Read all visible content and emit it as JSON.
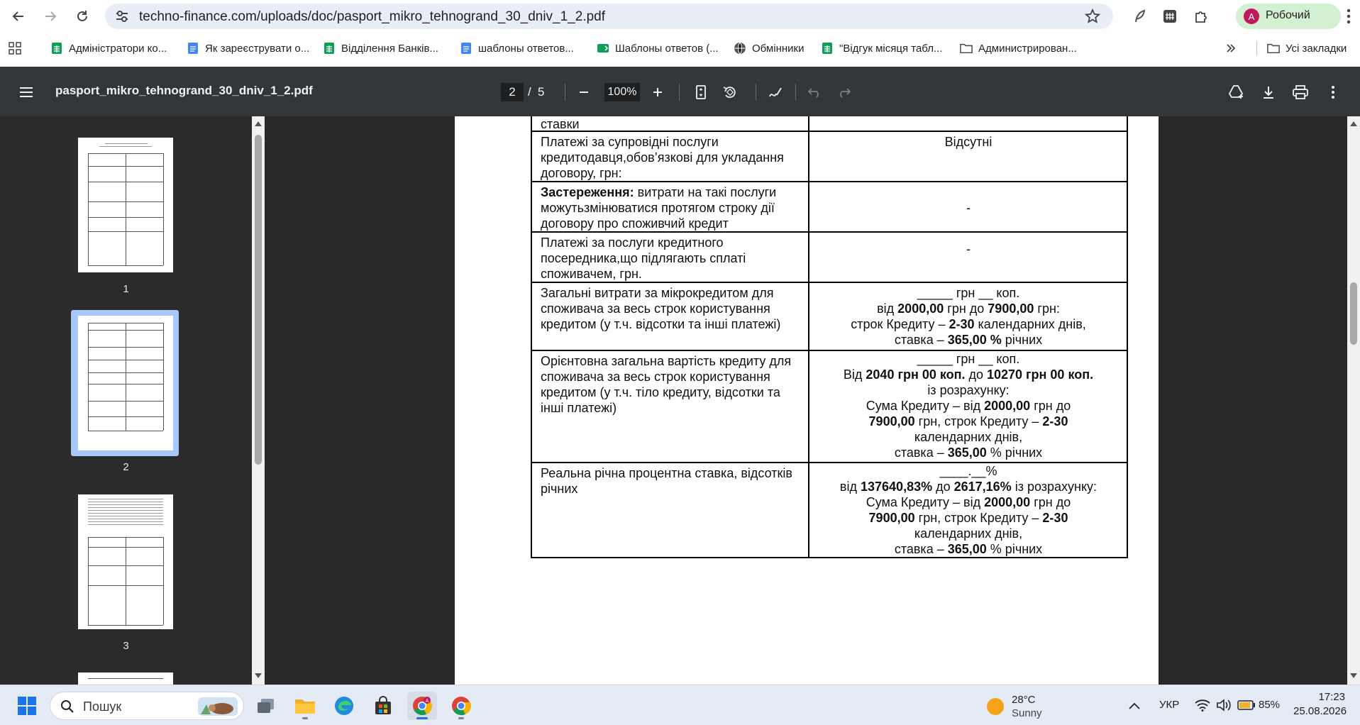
{
  "browser": {
    "url": "techno-finance.com/uploads/doc/pasport_mikro_tehnogrand_30_dniv_1_2.pdf",
    "profile_initial": "A",
    "profile_name": "Робочий",
    "accent_color": "#1a73e8"
  },
  "bookmarks": [
    {
      "label": "Адміністратори ко...",
      "icon": "sheets-icon"
    },
    {
      "label": "Як зареєструвати о...",
      "icon": "docs-icon"
    },
    {
      "label": "Відділення Банків...",
      "icon": "sheets-icon"
    },
    {
      "label": "шаблоны ответов...",
      "icon": "docs-icon"
    },
    {
      "label": "Шаблоны ответов (...",
      "icon": "slides-icon"
    },
    {
      "label": "Обмінники",
      "icon": "globe-icon"
    },
    {
      "label": "\"Відгук місяця табл...",
      "icon": "sheets-icon"
    },
    {
      "label": "Администрирован...",
      "icon": "folder-icon"
    }
  ],
  "all_bookmarks_label": "Усі закладки",
  "pdf": {
    "filename": "pasport_mikro_tehnogrand_30_dniv_1_2.pdf",
    "current_page": "2",
    "page_separator": "/",
    "total_pages": "5",
    "zoom": "100%"
  },
  "thumbnails": [
    {
      "number": "1"
    },
    {
      "number": "2"
    },
    {
      "number": "3"
    }
  ],
  "document": {
    "top_fragment": "ставки",
    "rows": [
      {
        "left": "Платежі за супровідні послуги кредитодавця,обов’язкові для укладання договору, грн:",
        "right": "Відсутні"
      },
      {
        "left_bold": "Застереження:",
        "left": " витрати на такі послуги можутьзмінюватися протягом строку дії договору про споживчий кредит",
        "right": "-"
      },
      {
        "left": "Платежі за послуги кредитного посередника,що підлягають сплаті споживачем, грн.",
        "right": "-"
      },
      {
        "left": "Загальні витрати за мікрокредитом для споживача за весь строк користування кредитом (у т.ч. відсотки та інші платежі)",
        "right_lines": [
          [
            "_____ грн __ коп."
          ],
          [
            "від ",
            "*2000,00",
            " грн до ",
            "*7900,00",
            " грн:"
          ],
          [
            "строк Кредиту – ",
            "*2-30",
            " календарних днів,"
          ],
          [
            "ставка – ",
            "*365,00 %",
            " річних"
          ]
        ]
      },
      {
        "left": "Орієнтовна загальна вартість кредиту для споживача за весь строк користування кредитом (у т.ч. тіло кредиту, відсотки та інші платежі)",
        "right_lines": [
          [
            "_____ грн __ коп."
          ],
          [
            "Від ",
            "*2040 грн 00 коп.",
            " до ",
            "*10270 грн 00 коп."
          ],
          [
            "із розрахунку:"
          ],
          [
            "Сума Кредиту – від ",
            "*2000,00",
            " грн до"
          ],
          [
            "*7900,00",
            " грн, строк Кредиту – ",
            "*2-30"
          ],
          [
            "календарних днів,"
          ],
          [
            "ставка – ",
            "*365,00",
            "  % річних"
          ]
        ]
      },
      {
        "left": "Реальна річна процентна ставка, відсотків річних",
        "right_lines": [
          [
            "____.__%"
          ],
          [
            "від ",
            "*137640,83%",
            " до  ",
            "*2617,16%",
            " із розрахунку:"
          ],
          [
            "Сума Кредиту – від ",
            "*2000,00",
            " грн до"
          ],
          [
            "*7900,00",
            " грн, строк Кредиту – ",
            "*2-30"
          ],
          [
            "календарних днів,"
          ],
          [
            "ставка – ",
            "*365,00",
            " % річних"
          ]
        ]
      }
    ]
  },
  "taskbar": {
    "search_label": "Пошук",
    "weather_temp": "28°C",
    "weather_desc": "Sunny",
    "language": "УКР",
    "battery": "85%",
    "time": "17:23",
    "date": "25.08.2026"
  }
}
